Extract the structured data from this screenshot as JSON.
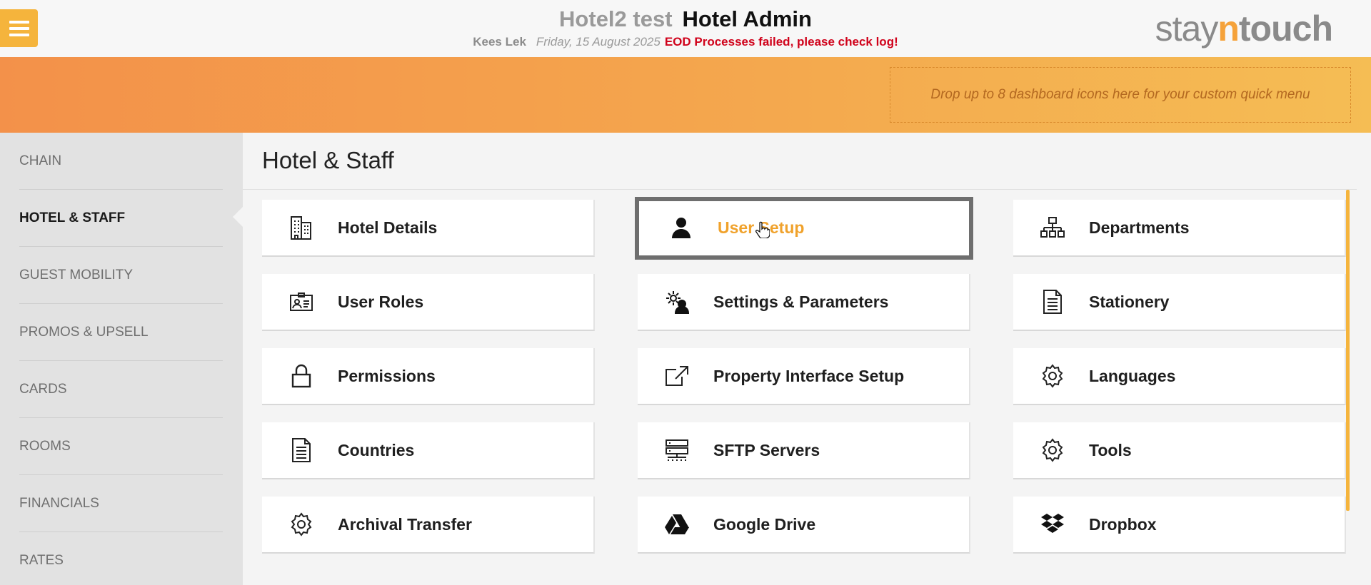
{
  "header": {
    "hotel_name": "Hotel2 test",
    "title": "Hotel Admin",
    "user_name": "Kees Lek",
    "date": "Friday, 15 August 2025",
    "eod_error": "EOD Processes failed, please check log!",
    "logo_part1": "stay",
    "logo_part2": "n",
    "logo_part3": "touch"
  },
  "quick_menu": {
    "placeholder": "Drop up to 8 dashboard icons here for your custom quick menu"
  },
  "sidebar": {
    "items": [
      {
        "label": "CHAIN"
      },
      {
        "label": "HOTEL & STAFF",
        "active": true
      },
      {
        "label": "GUEST MOBILITY"
      },
      {
        "label": "PROMOS & UPSELL"
      },
      {
        "label": "CARDS"
      },
      {
        "label": "ROOMS"
      },
      {
        "label": "FINANCIALS"
      },
      {
        "label": "RATES"
      }
    ]
  },
  "main": {
    "title": "Hotel & Staff",
    "tiles": [
      {
        "label": "Hotel Details",
        "icon": "building-icon"
      },
      {
        "label": "User Setup",
        "icon": "user-icon",
        "selected": true
      },
      {
        "label": "Departments",
        "icon": "org-chart-icon"
      },
      {
        "label": "User Roles",
        "icon": "id-card-icon"
      },
      {
        "label": "Settings & Parameters",
        "icon": "user-settings-icon"
      },
      {
        "label": "Stationery",
        "icon": "document-icon"
      },
      {
        "label": "Permissions",
        "icon": "lock-icon"
      },
      {
        "label": "Property Interface Setup",
        "icon": "external-link-icon"
      },
      {
        "label": "Languages",
        "icon": "gear-icon"
      },
      {
        "label": "Countries",
        "icon": "document-icon"
      },
      {
        "label": "SFTP Servers",
        "icon": "server-icon"
      },
      {
        "label": "Tools",
        "icon": "gear-icon"
      },
      {
        "label": "Archival Transfer",
        "icon": "gear-icon"
      },
      {
        "label": "Google Drive",
        "icon": "google-drive-icon"
      },
      {
        "label": "Dropbox",
        "icon": "dropbox-icon"
      }
    ]
  },
  "colors": {
    "accent": "#f5b43c",
    "selected_text": "#f0a22c",
    "error": "#d0021b"
  }
}
